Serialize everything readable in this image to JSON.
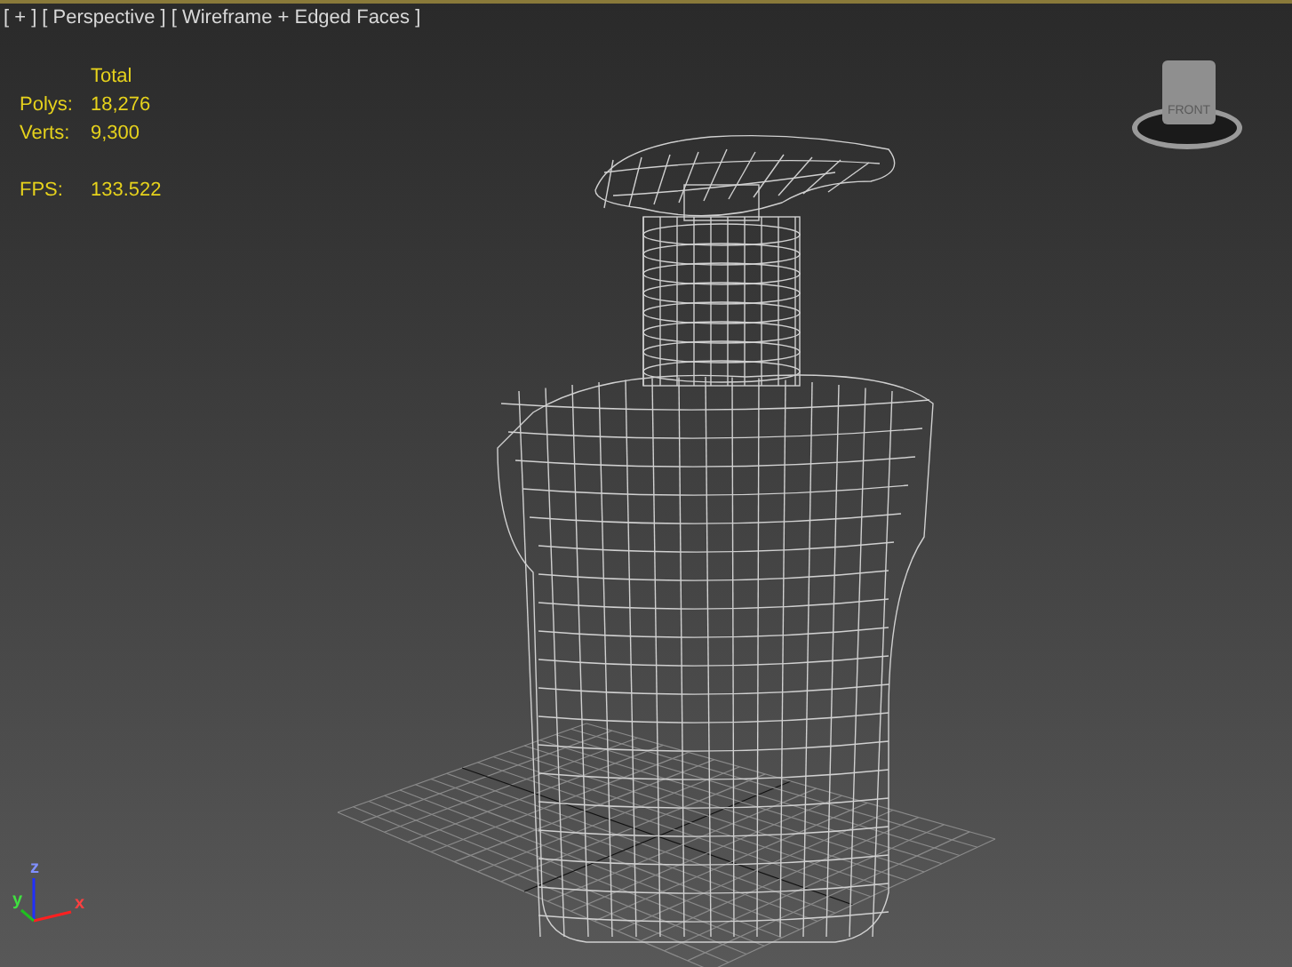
{
  "viewport_menus": [
    "[ + ]",
    "[ Perspective ]",
    "[ Wireframe + Edged Faces ]"
  ],
  "stats": {
    "header": "Total",
    "rows": [
      {
        "label": "Polys:",
        "value": "18,276"
      },
      {
        "label": "Verts:",
        "value": "9,300"
      },
      {
        "label": "FPS:",
        "value": "133.522"
      }
    ]
  },
  "viewcube": {
    "face_label": "FRONT"
  },
  "axis_tripod": {
    "x": "x",
    "y": "y",
    "z": "z"
  }
}
